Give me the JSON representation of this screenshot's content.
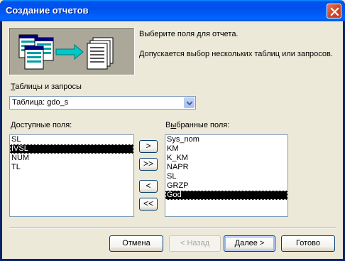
{
  "window": {
    "title": "Создание отчетов"
  },
  "intro": {
    "line1": "Выберите поля для отчета.",
    "line2": "Допускается выбор нескольких таблиц или запросов."
  },
  "source": {
    "label": "Таблицы и запросы",
    "label_accel": "Т",
    "label_rest": "аблицы и запросы",
    "selected": "Таблица: gdo_s"
  },
  "available": {
    "label_accel": "Д",
    "label_rest": "оступные поля:",
    "items": [
      "SL",
      "IVSL",
      "NUM",
      "TL"
    ],
    "selected_index": 1
  },
  "selected_fields": {
    "label_pre": "В",
    "label_accel": "ы",
    "label_rest": "бранные поля:",
    "items": [
      "Sys_nom",
      "KM",
      "K_KM",
      "NAPR",
      "SL",
      "GRZP",
      "God"
    ],
    "selected_index": 6
  },
  "move_buttons": {
    "add_one": ">",
    "add_all": ">>",
    "remove_one": "<",
    "remove_all": "<<"
  },
  "buttons": {
    "cancel": "Отмена",
    "back": "< Назад",
    "next": "Далее >",
    "finish": "Готово"
  },
  "colors": {
    "title_bar": "#0054e3",
    "face": "#ece9d8",
    "selection": "#000000"
  }
}
